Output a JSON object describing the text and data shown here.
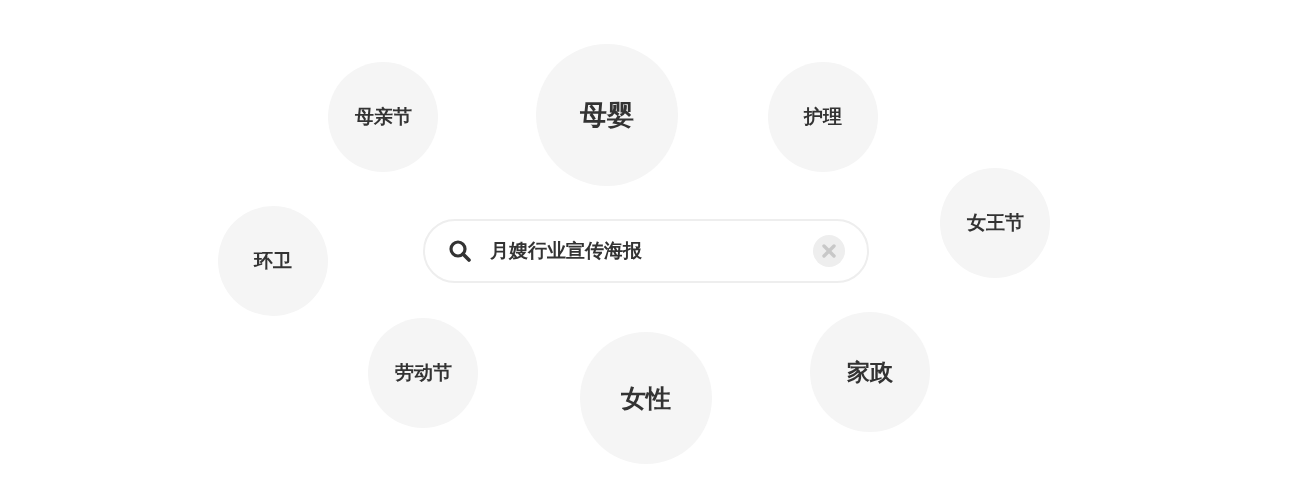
{
  "search": {
    "value": "月嫂行业宣传海报"
  },
  "tags": [
    {
      "label": "母亲节",
      "kind": "small"
    },
    {
      "label": "母婴",
      "kind": "large"
    },
    {
      "label": "护理",
      "kind": "small"
    },
    {
      "label": "女王节",
      "kind": "small"
    },
    {
      "label": "环卫",
      "kind": "small"
    },
    {
      "label": "劳动节",
      "kind": "small"
    },
    {
      "label": "女性",
      "kind": "big"
    },
    {
      "label": "家政",
      "kind": "medium"
    }
  ]
}
